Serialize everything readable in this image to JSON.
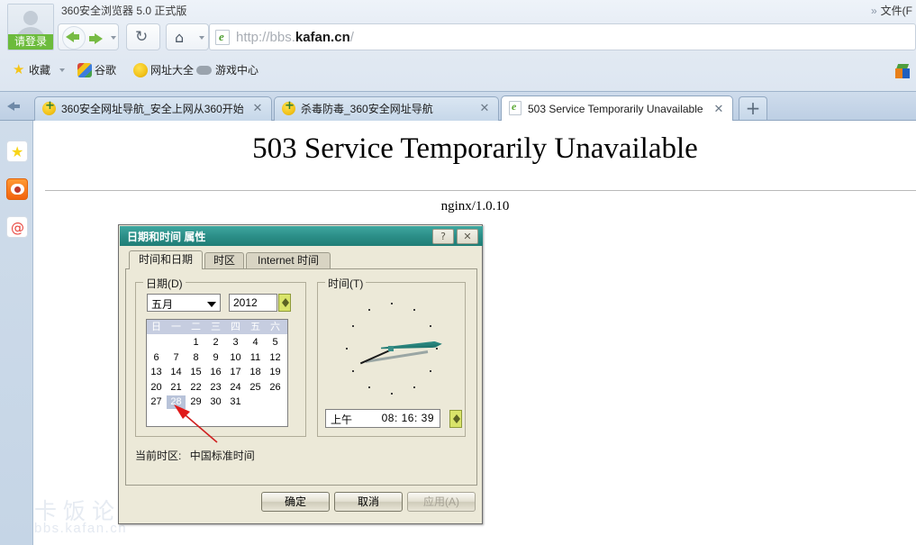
{
  "browser": {
    "app_title": "360安全浏览器 5.0 正式版",
    "menu_right": "文件(F",
    "chevron": "»",
    "login_label": "请登录",
    "url": {
      "prefix": "http://bbs.",
      "host": "kafan.cn",
      "suffix": "/",
      "full": "http://bbs.kafan.cn/"
    },
    "nav": {
      "back": "back-arrow",
      "forward": "forward-arrow",
      "reload": "↻",
      "home": "⌂"
    },
    "bookmarks": [
      {
        "label": "收藏",
        "icon": "star-icon",
        "has_caret": true
      },
      {
        "label": "谷歌",
        "icon": "google-icon",
        "has_caret": false
      },
      {
        "label": "网址大全",
        "icon": "hao360-icon",
        "has_caret": false
      },
      {
        "label": "游戏中心",
        "icon": "gamepad-icon",
        "has_caret": false
      }
    ],
    "tabs": [
      {
        "title": "360安全网址导航_安全上网从360开始",
        "favicon": "360-icon",
        "active": false
      },
      {
        "title": "杀毒防毒_360安全网址导航",
        "favicon": "360-icon",
        "active": false
      },
      {
        "title": "503 Service Temporarily Unavailable",
        "favicon": "page-icon",
        "active": true
      }
    ],
    "new_tab_label": "+",
    "close_label": "✕",
    "sidebar": [
      {
        "name": "favorites",
        "icon": "star-icon"
      },
      {
        "name": "weibo",
        "icon": "weibo-eye-icon"
      },
      {
        "name": "mail",
        "icon": "at-icon"
      }
    ]
  },
  "page": {
    "error_title": "503 Service Temporarily Unavailable",
    "server": "nginx/1.0.10"
  },
  "watermark": {
    "cn": "卡饭论坛",
    "en": "bbs.kafan.cn"
  },
  "dialog": {
    "title": "日期和时间 属性",
    "help_btn": "?",
    "close_btn": "✕",
    "tabs": [
      {
        "label": "时间和日期",
        "selected": true
      },
      {
        "label": "时区",
        "selected": false
      },
      {
        "label": "Internet 时间",
        "selected": false
      }
    ],
    "date_group": {
      "legend": "日期(D)",
      "month": "五月",
      "year": "2012",
      "weekdays": [
        "日",
        "一",
        "二",
        "三",
        "四",
        "五",
        "六"
      ],
      "weeks": [
        [
          "",
          "",
          "1",
          "2",
          "3",
          "4",
          "5"
        ],
        [
          "6",
          "7",
          "8",
          "9",
          "10",
          "11",
          "12"
        ],
        [
          "13",
          "14",
          "15",
          "16",
          "17",
          "18",
          "19"
        ],
        [
          "20",
          "21",
          "22",
          "23",
          "24",
          "25",
          "26"
        ],
        [
          "27",
          "28",
          "29",
          "30",
          "31",
          "",
          ""
        ],
        [
          "",
          "",
          "",
          "",
          "",
          "",
          ""
        ]
      ],
      "selected_day": "28"
    },
    "time_group": {
      "legend": "时间(T)",
      "ampm": "上午",
      "time": "08: 16: 39",
      "hour": 8,
      "minute": 16,
      "second": 39
    },
    "timezone_label": "当前时区:",
    "timezone_value": "中国标准时间",
    "buttons": {
      "ok": "确定",
      "cancel": "取消",
      "apply": "应用(A)"
    }
  },
  "colors": {
    "dialog_title_bar": "#2c8f88",
    "dialog_face": "#ece9d8",
    "login_green": "#6cbb3c",
    "spinner_highlight": "#d9e46a",
    "annotation_red": "#e01b1b",
    "calendar_select": "#b8c3d9"
  }
}
